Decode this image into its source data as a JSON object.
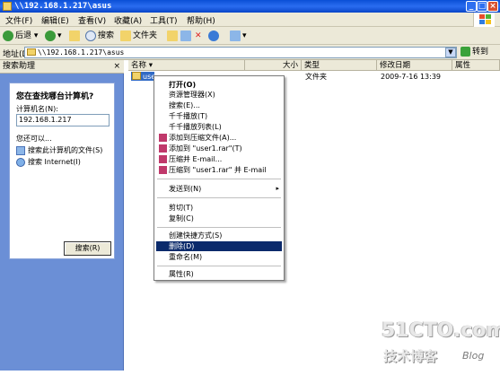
{
  "window": {
    "title": "\\\\192.168.1.217\\asus"
  },
  "menubar": {
    "items": [
      "文件(F)",
      "编辑(E)",
      "查看(V)",
      "收藏(A)",
      "工具(T)",
      "帮助(H)"
    ]
  },
  "toolbar": {
    "back_label": "后退",
    "search_label": "搜索",
    "folders_label": "文件夹"
  },
  "address": {
    "label": "地址(D)",
    "value": "\\\\192.168.1.217\\asus",
    "go_label": "转到"
  },
  "sidebar": {
    "header": "搜索助理",
    "close": "×",
    "title": "您在查找哪台计算机?",
    "computer_label": "计算机名(N):",
    "computer_value": "192.168.1.217",
    "more_label": "您还可以...",
    "link_files": "搜索此计算机的文件(S)",
    "link_internet": "搜索 Internet(I)",
    "search_button": "搜索(R)"
  },
  "content": {
    "columns": {
      "name": "名称",
      "size": "大小",
      "type": "类型",
      "modified": "修改日期",
      "attr": "属性"
    },
    "row": {
      "name": "user",
      "type": "文件夹",
      "modified": "2009-7-16 13:39"
    }
  },
  "context_menu": {
    "items": [
      {
        "label": "打开(O)",
        "bold": true
      },
      {
        "label": "资源管理器(X)"
      },
      {
        "label": "搜索(E)..."
      },
      {
        "label": "千千播放(T)"
      },
      {
        "label": "千千播放列表(L)"
      },
      {
        "label": "添加到压缩文件(A)..."
      },
      {
        "label": "添加到 \"user1.rar\"(T)"
      },
      {
        "label": "压缩并 E-mail..."
      },
      {
        "label": "压缩到 \"user1.rar\" 并 E-mail"
      },
      {
        "label": "发送到(N)",
        "submenu": "▸"
      },
      {
        "label": "剪切(T)"
      },
      {
        "label": "复制(C)"
      },
      {
        "label": "创建快捷方式(S)"
      },
      {
        "label": "删除(D)",
        "highlighted": true
      },
      {
        "label": "重命名(M)"
      },
      {
        "label": "属性(R)"
      }
    ]
  },
  "watermark": {
    "brand": "51CTO.com",
    "sub": "技术博客",
    "blog": "Blog"
  }
}
